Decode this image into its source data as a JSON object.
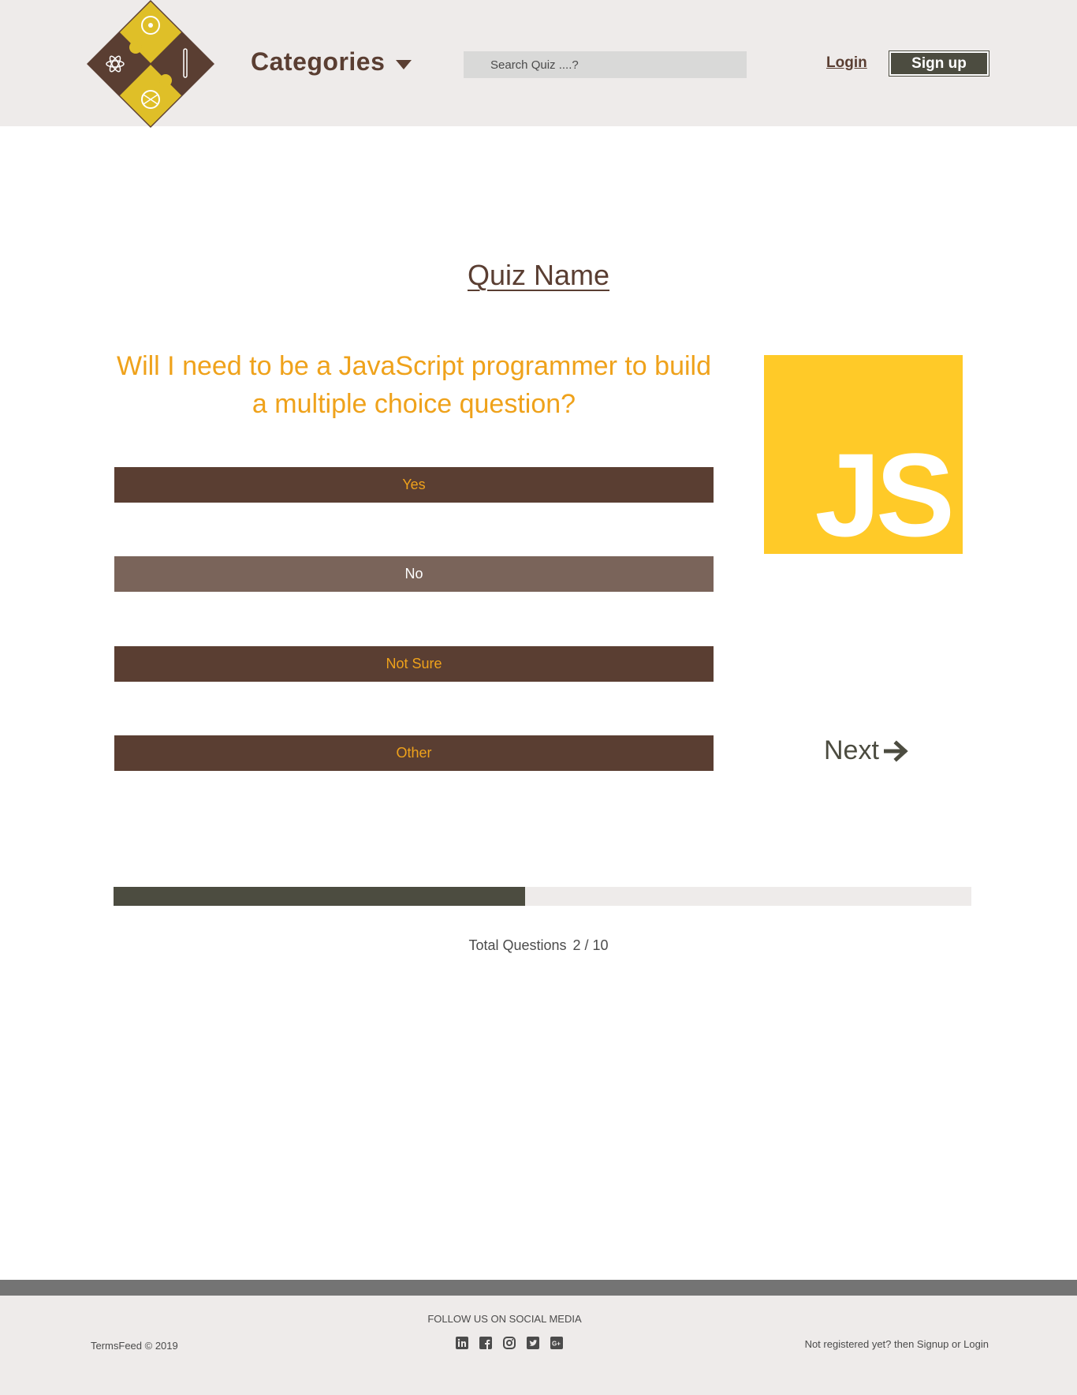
{
  "header": {
    "categories_label": "Categories",
    "search_placeholder": "Search Quiz ....?",
    "login_label": "Login",
    "signup_label": "Sign up"
  },
  "quiz": {
    "name": "Quiz Name",
    "question": "Will I need to be a JavaScript programmer to build a multiple choice question?",
    "answers": [
      {
        "label": "Yes",
        "selected": false
      },
      {
        "label": "No",
        "selected": true
      },
      {
        "label": "Not Sure",
        "selected": false
      },
      {
        "label": "Other",
        "selected": false
      }
    ],
    "image_text": "JS",
    "next_label": "Next"
  },
  "progress": {
    "fraction": 0.48,
    "total_label": "Total Questions",
    "count": "2 / 10"
  },
  "footer": {
    "copyright": "TermsFeed © 2019",
    "follow_label": "FOLLOW US ON SOCIAL MEDIA",
    "socials": [
      "linkedin-icon",
      "facebook-icon",
      "instagram-icon",
      "twitter-icon",
      "google-plus-icon"
    ],
    "register_text": "Not registered yet? then Signup or Login"
  },
  "colors": {
    "brown": "#5a3e32",
    "orange": "#efa21b",
    "selected": "#7a645a",
    "js_yellow": "#ffca28",
    "dark_olive": "#4c4c40"
  }
}
